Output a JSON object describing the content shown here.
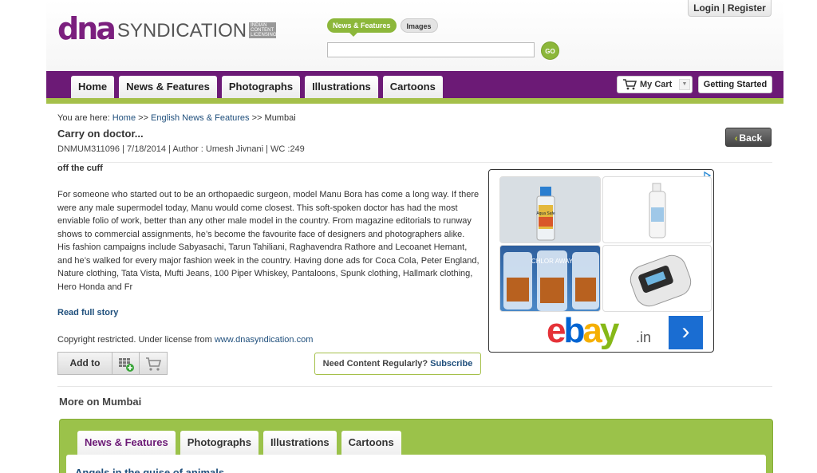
{
  "header": {
    "logo_dna": "dna",
    "logo_syndication": "SYNDICATION",
    "logo_tagline": "INDIAN CONTENT LICENSING",
    "login_register": "Login | Register",
    "search_tabs": [
      {
        "label": "News & Features",
        "active": true
      },
      {
        "label": "Images",
        "active": false
      }
    ],
    "search_placeholder": "",
    "go_label": "GO"
  },
  "nav": {
    "tabs": [
      "Home",
      "News & Features",
      "Photographs",
      "Illustrations",
      "Cartoons"
    ],
    "cart_label": "My Cart",
    "getting_started": "Getting Started"
  },
  "breadcrumb": {
    "prefix": "You are here:",
    "items": [
      "Home",
      "English News & Features",
      "Mumbai"
    ],
    "separator": ">>"
  },
  "article": {
    "title": "Carry on doctor...",
    "meta": "DNMUM311096 | 7/18/2014 | Author : Umesh Jivnani | WC :249",
    "back_label": "Back",
    "kicker": "off the cuff",
    "paragraph1": "For someone who started out to be an orthopaedic surgeon, model Manu Bora has come a long way. If there were any male supermodel today, Manu would come closest. This soft-spoken doctor has had the most enviable folio of work, better than any other male model in the country. From magazine editorials to runway shows to commercial assignments, he’s become the favourite face of designers and photographers alike.",
    "paragraph2": "His fashion campaigns include Sabyasachi, Tarun Tahiliani, Raghavendra Rathore and Lecoanet Hemant, and he’s walked for every major fashion week in the country. Having done ads for Coca Cola, Peter England, Nature clothing, Tata Vista, Mufti Jeans, 100 Piper Whiskey, Pantaloons, Spunk clothing, Hallmark clothing, Hero Honda and Fr",
    "read_full_story": "Read full story",
    "copyright_prefix": "Copyright restricted. Under license from",
    "copyright_link": "www.dnasyndication.com",
    "add_to_label": "Add to",
    "need_content": "Need Content Regularly?",
    "subscribe": "Subscribe"
  },
  "ad": {
    "brand_ebay": [
      "e",
      "b",
      "a",
      "y"
    ],
    "brand_suffix": ".in",
    "tiles": [
      "Aqua Safe",
      "",
      "CHLOR AWAY",
      ""
    ]
  },
  "more": {
    "title": "More on Mumbai",
    "tabs": [
      {
        "label": "News & Features",
        "active": true
      },
      {
        "label": "Photographs",
        "active": false
      },
      {
        "label": "Illustrations",
        "active": false
      },
      {
        "label": "Cartoons",
        "active": false
      }
    ],
    "first_item": "Angels in the guise of animals"
  },
  "colors": {
    "brand_purple": "#6c1a76",
    "brand_green": "#9bc24a",
    "link_blue": "#1f4f7c"
  }
}
